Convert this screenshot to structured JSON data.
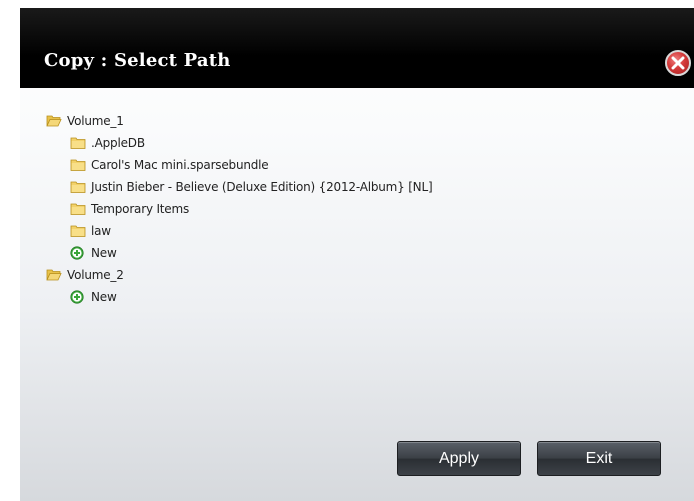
{
  "dialog": {
    "title": "Copy : Select Path",
    "close_icon": "close-icon"
  },
  "tree": {
    "volume_1": {
      "label": "Volume_1",
      "children": [
        ".AppleDB",
        "Carol's Mac mini.sparsebundle",
        "Justin Bieber - Believe (Deluxe Edition) {2012-Album} [NL]",
        "Temporary Items",
        "law"
      ],
      "new_label": "New"
    },
    "volume_2": {
      "label": "Volume_2",
      "new_label": "New"
    }
  },
  "buttons": {
    "apply": "Apply",
    "exit": "Exit"
  },
  "colors": {
    "titlebar": "#000000",
    "close_button": "#d43a3a",
    "folder": "#e8c24a",
    "new_icon": "#3aa63a",
    "button_dark": "#3a3f45"
  }
}
